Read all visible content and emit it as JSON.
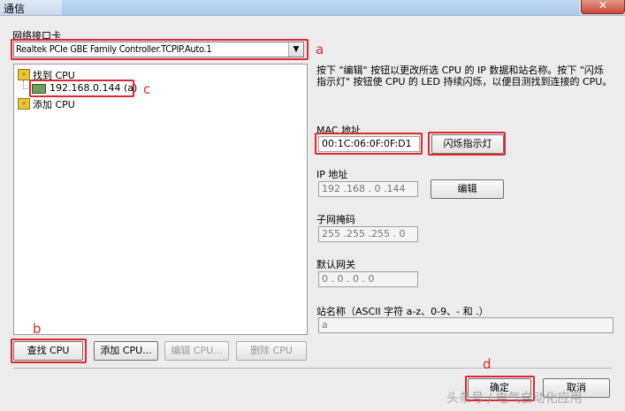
{
  "window": {
    "title": "通信",
    "close_glyph": "✕"
  },
  "interface": {
    "label": "网络接口卡",
    "selected": "Realtek PCIe GBE Family Controller.TCPIP.Auto.1"
  },
  "tree": {
    "found_label": "找到 CPU",
    "device_label": "192.168.0.144 (a)",
    "add_label": "添加 CPU"
  },
  "info_text": "按下 \"编辑\" 按钮以更改所选 CPU 的 IP 数据和站名称。按下 \"闪烁指示灯\" 按钮使 CPU 的 LED 持续闪烁，以便目测找到连接的 CPU。",
  "mac": {
    "label": "MAC 地址",
    "value": "00:1C:06:0F:0F:D1",
    "blink_button": "闪烁指示灯"
  },
  "ip": {
    "label": "IP 地址",
    "value": "192 .168 .  0  .144",
    "edit_button": "编辑"
  },
  "subnet": {
    "label": "子网掩码",
    "value": "255 .255 .255 .  0"
  },
  "gateway": {
    "label": "默认网关",
    "value": "  0  .  0  .  0  .  0"
  },
  "station": {
    "label": "站名称（ASCII 字符 a-z、0-9、- 和 .）",
    "value": "a"
  },
  "buttons": {
    "find": "查找 CPU",
    "add": "添加 CPU...",
    "edit_cpu": "编辑 CPU...",
    "delete_cpu": "删除 CPU",
    "ok": "确定",
    "cancel": "取消"
  },
  "annotations": {
    "a": "a",
    "b": "b",
    "c": "c",
    "d": "d"
  },
  "watermark": "头条号 / 电气自动化应用",
  "colors": {
    "highlight": "#e0282c"
  }
}
